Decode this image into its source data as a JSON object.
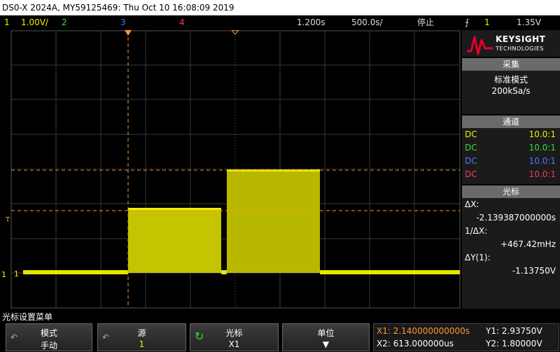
{
  "titlebar": {
    "text": "DS0-X 2024A, MY59125469: Thu Oct 10 16:08:09 2019"
  },
  "status": {
    "ch1_num": "1",
    "ch1_scale": "1.00V/",
    "ch2_num": "2",
    "ch3_num": "3",
    "ch4_num": "4",
    "time_pos": "1.200s",
    "time_scale": "500.0s/",
    "run_state": "停止",
    "trig_source": "1",
    "trig_level": "1.35V"
  },
  "colors": {
    "ch1": "#f0f000",
    "ch2": "#33dd33",
    "ch3": "#5577ff",
    "ch4": "#ff3366",
    "cursor": "#ff9933",
    "accent": "#ffaa33"
  },
  "markers": {
    "ground": "1",
    "trigger": "T"
  },
  "panel": {
    "brand": "KEYSIGHT",
    "brand_sub": "TECHNOLOGIES",
    "acq_title": "采集",
    "acq_mode": "标准模式",
    "acq_rate": "200kSa/s",
    "chan_title": "通道",
    "channels": [
      {
        "coupling": "DC",
        "probe": "10.0:1"
      },
      {
        "coupling": "DC",
        "probe": "10.0:1"
      },
      {
        "coupling": "DC",
        "probe": "10.0:1"
      },
      {
        "coupling": "DC",
        "probe": "10.0:1"
      }
    ],
    "cur_title": "光标",
    "dx_label": "ΔX:",
    "dx_value": "-2.139387000000s",
    "inv_dx_label": "1/ΔX:",
    "inv_dx_value": "+467.42mHz",
    "dy_label": "ΔY(1):",
    "dy_value": "-1.13750V"
  },
  "menu": {
    "title": "光标设置菜单",
    "keys": [
      {
        "top": "模式",
        "bottom": "手动"
      },
      {
        "top": "源",
        "bottom": "1"
      },
      {
        "top": "光标",
        "bottom": "X1"
      },
      {
        "top": "单位",
        "bottom": ""
      }
    ]
  },
  "cursors": {
    "x1": "X1: 2.140000000000s",
    "x2": "X2: 613.000000us",
    "y1": "Y1: 2.93750V",
    "y2": "Y2: 1.80000V"
  }
}
